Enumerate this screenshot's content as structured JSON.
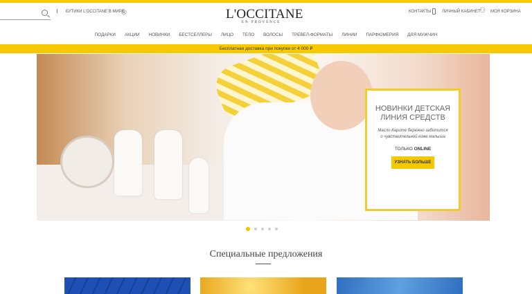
{
  "header": {
    "stores_label": "БУТИКИ L'OCCITANE В МИРЕ",
    "logo": "L'OCCITANE",
    "logo_sub": "EN PROVENCE",
    "contacts": "КОНТАКТЫ",
    "account": "ЛИЧНЫЙ КАБИНЕТ",
    "cart": "МОЯ КОРЗИНА"
  },
  "nav": [
    "ПОДАРКИ",
    "АКЦИИ",
    "НОВИНКИ",
    "БЕСТСЕЛЛЕРЫ",
    "ЛИЦО",
    "ТЕЛО",
    "ВОЛОСЫ",
    "ТРЕВЕЛ-ФОРМАТЫ",
    "ЛИНИИ",
    "ПАРФЮМЕРИЯ",
    "ДЛЯ МУЖЧИН"
  ],
  "shipping": "Бесплатная доставка при покупке от 4 000 ₽",
  "promo": {
    "title": "НОВИНКИ ДЕТСКАЯ ЛИНИЯ СРЕДСТВ",
    "text": "Масло Карите бережно заботится о чувствительной коже малыша",
    "only": "ТОЛЬКО",
    "online": "ONLINE",
    "cta": "УЗНАТЬ БОЛЬШЕ"
  },
  "carousel": {
    "slides": 5,
    "active": 1
  },
  "section": {
    "title": "Специальные предложения"
  },
  "colors": {
    "accent": "#f6c900",
    "card1": "#1e4fb5",
    "card2": "#e8a51a",
    "card3": "#2f6fc0"
  }
}
